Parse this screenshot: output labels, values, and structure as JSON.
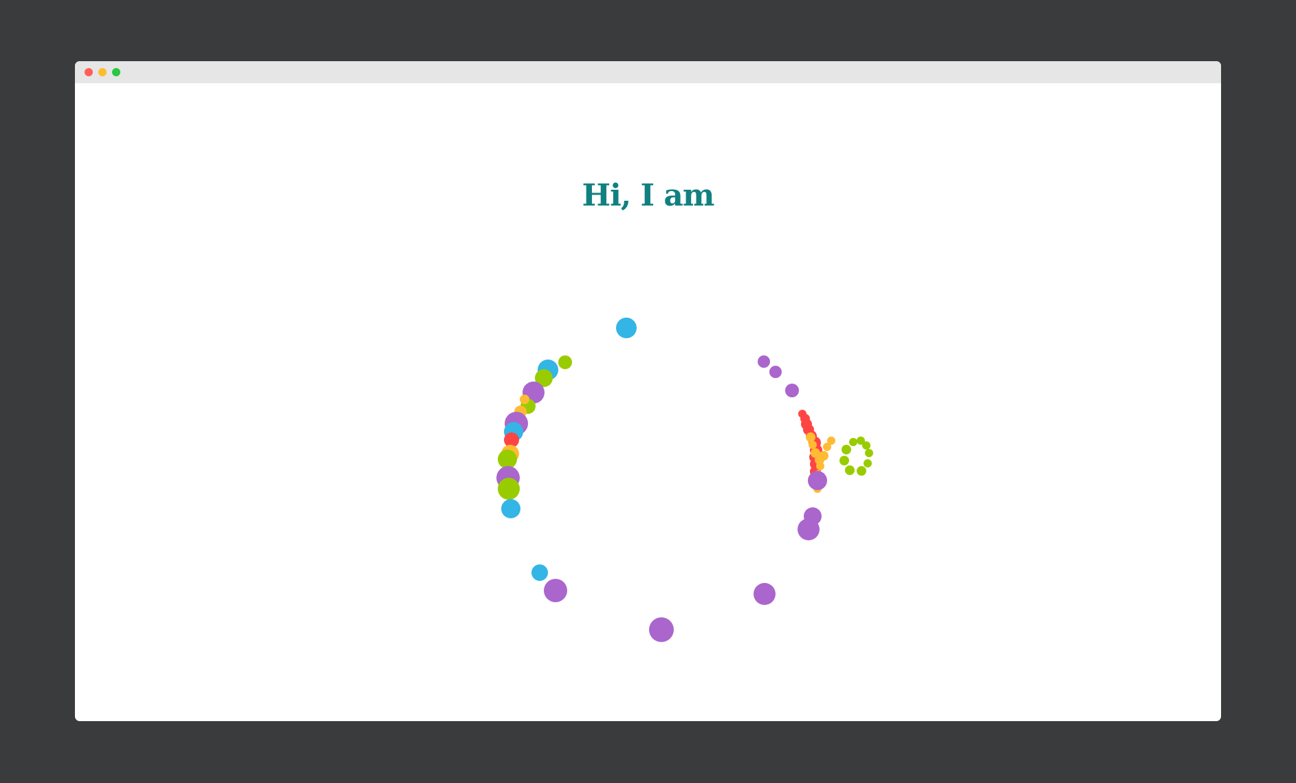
{
  "window": {
    "controls": [
      {
        "name": "close",
        "color": "#ff5f57"
      },
      {
        "name": "minimize",
        "color": "#febc2e"
      },
      {
        "name": "maximize",
        "color": "#28c840"
      }
    ]
  },
  "heading": {
    "text": "Hi, I am",
    "color": "#118080"
  },
  "particle_colors": {
    "purple": "#aa66cc",
    "blue": "#33b5e5",
    "green": "#99cc00",
    "orange": "#ffbb33",
    "red": "#ff4444"
  }
}
